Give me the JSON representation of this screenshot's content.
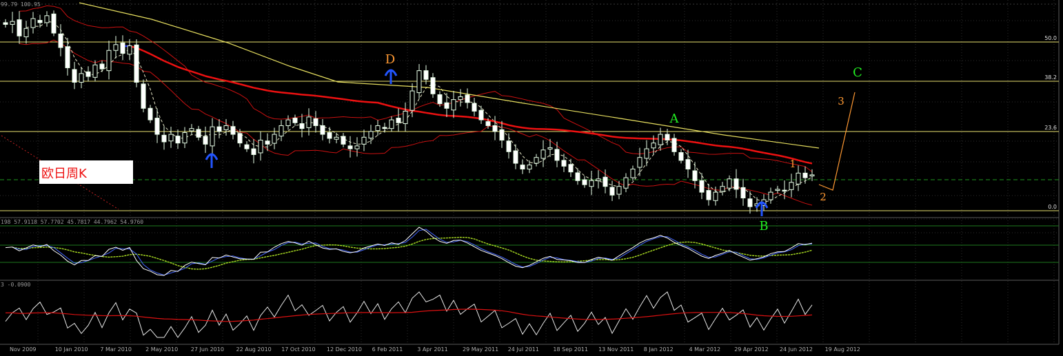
{
  "chart_data": {
    "type": "candlestick",
    "title": "欧日周K",
    "main_header": "99.79 100.95",
    "rsi_header": "198 57.9118 57.7702 45.7817 44.7962 54.9760",
    "osc_header": "3 -0.0900",
    "fib_levels": [
      {
        "label": "50.0"
      },
      {
        "label": "38.2"
      },
      {
        "label": "23.6"
      },
      {
        "label": "0.0"
      }
    ],
    "wave_labels": [
      {
        "text": "D",
        "color": "#ff9933"
      },
      {
        "text": "A",
        "color": "#22ee22"
      },
      {
        "text": "B",
        "color": "#22ee22"
      },
      {
        "text": "C",
        "color": "#22ee22"
      },
      {
        "text": "1",
        "color": "#ff9933"
      },
      {
        "text": "2",
        "color": "#ff9933"
      },
      {
        "text": "3",
        "color": "#ff9933"
      }
    ],
    "x_ticks": [
      "Nov 2009",
      "10 Jan 2010",
      "7 Mar 2010",
      "2 May 2010",
      "27 Jun 2010",
      "22 Aug 2010",
      "17 Oct 2010",
      "12 Dec 2010",
      "6 Feb 2011",
      "3 Apr 2011",
      "29 May 2011",
      "24 Jul 2011",
      "18 Sep 2011",
      "13 Nov 2011",
      "8 Jan 2012",
      "4 Mar 2012",
      "29 Apr 2012",
      "24 Jun 2012",
      "19 Aug 2012"
    ],
    "closes": [
      120.5,
      121.0,
      118.5,
      119.8,
      121.5,
      120.8,
      122.0,
      119.0,
      116.5,
      113.0,
      110.5,
      112.0,
      111.5,
      113.5,
      112.8,
      116.0,
      117.0,
      115.5,
      116.8,
      110.5,
      106.0,
      104.0,
      101.5,
      100.2,
      101.5,
      100.0,
      101.8,
      102.5,
      101.0,
      99.8,
      102.8,
      102.0,
      103.0,
      101.5,
      100.0,
      99.0,
      98.0,
      100.5,
      99.8,
      101.5,
      103.0,
      104.0,
      103.5,
      102.5,
      104.5,
      103.0,
      101.5,
      100.8,
      101.0,
      99.8,
      99.0,
      99.5,
      101.0,
      102.0,
      103.0,
      102.5,
      104.0,
      103.5,
      105.5,
      109.0,
      112.5,
      111.0,
      108.5,
      106.8,
      106.0,
      107.5,
      108.0,
      107.0,
      105.5,
      104.0,
      103.0,
      102.0,
      100.5,
      98.5,
      96.5,
      95.5,
      96.2,
      97.5,
      98.8,
      99.2,
      97.0,
      96.0,
      95.0,
      93.5,
      92.8,
      93.5,
      93.8,
      92.5,
      91.0,
      92.5,
      94.0,
      95.5,
      97.5,
      99.0,
      100.0,
      101.5,
      100.5,
      98.5,
      97.0,
      95.5,
      93.5,
      91.5,
      90.2,
      91.5,
      92.5,
      93.8,
      92.0,
      90.5,
      89.0,
      89.5,
      90.2,
      91.5,
      92.0,
      91.8,
      93.2,
      94.8,
      94.0,
      94.5
    ]
  }
}
